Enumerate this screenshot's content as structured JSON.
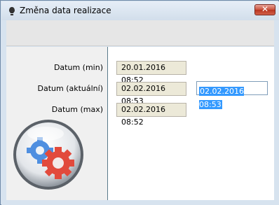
{
  "window": {
    "title": "Změna data realizace",
    "close_glyph": "✕"
  },
  "form": {
    "min_label": "Datum (min)",
    "min_value": "20.01.2016 08:52",
    "current_label": "Datum (aktuální)",
    "current_value": "02.02.2016 08:53",
    "current_edit_value": "02.02.2016 08:53",
    "max_label": "Datum (max)",
    "max_value": "02.02.2016 08:52"
  },
  "icons": {
    "title": "lamp-icon",
    "logo": "gears-logo-icon",
    "close": "close-icon"
  },
  "colors": {
    "selection": "#3399ff",
    "close_button": "#c9503c",
    "gear_blue": "#4f8fe0",
    "gear_red": "#e24a3c"
  }
}
